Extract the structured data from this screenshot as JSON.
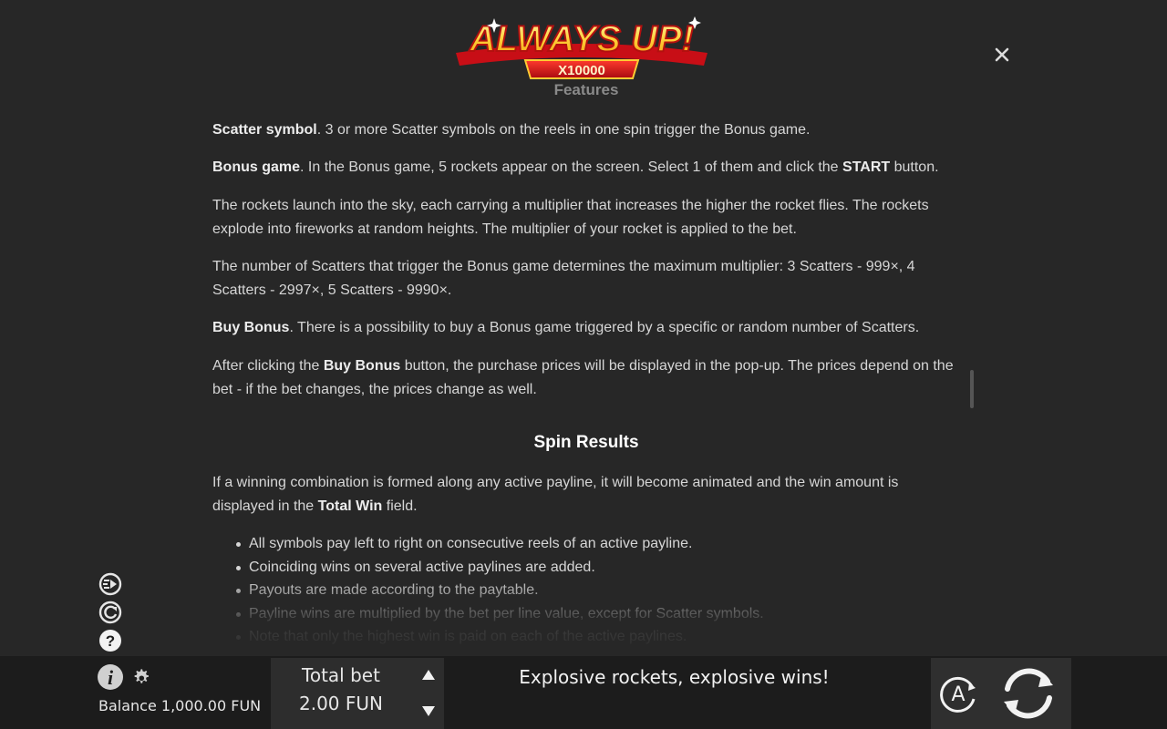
{
  "logo": {
    "text": "ALWAYS UP!",
    "sub": "X10000"
  },
  "rules": {
    "cut_heading": "Features",
    "scatter": {
      "term": "Scatter symbol",
      "text": ". 3 or more Scatter symbols on the reels in one spin trigger the Bonus game."
    },
    "bonus": {
      "term": "Bonus game",
      "text1": ". In the Bonus game, 5 rockets appear on the screen. Select 1 of them and click the ",
      "term2": "START",
      "text2": " button."
    },
    "rockets": "The rockets launch into the sky, each carrying a multiplier that increases the higher the rocket flies. The rockets explode into fireworks at random heights. The multiplier of your rocket is applied to the bet.",
    "scatters_count": "The number of Scatters that trigger the Bonus game determines the maximum multiplier: 3 Scatters - 999×, 4 Scatters - 2997×, 5 Scatters - 9990×.",
    "buy": {
      "term": "Buy Bonus",
      "text": ". There is a possibility to buy a Bonus game triggered by a specific or random number of Scatters."
    },
    "after": {
      "text1": "After clicking the ",
      "term": "Buy Bonus",
      "text2": " button, the purchase prices will be displayed in the pop-up. The prices depend on the bet - if the bet changes, the prices change as well."
    },
    "spin_heading": "Spin Results",
    "spin_intro": {
      "text1": "If a winning combination is formed along any active payline, it will become animated and the win amount is displayed in the ",
      "term": "Total Win",
      "text2": " field."
    },
    "bullets": [
      "All symbols pay left to right on consecutive reels of an active payline.",
      "Coinciding wins on several active paylines are added.",
      "Payouts are made according to the paytable.",
      "Payline wins are multiplied by the bet per line value, except for Scatter symbols.",
      "Note that only the highest win is paid on each of the active paylines."
    ]
  },
  "bottom": {
    "balance_label": "Balance",
    "balance_value": "1,000.00 FUN",
    "bet_label": "Total bet",
    "bet_value": "2.00 FUN",
    "message": "Explosive rockets, explosive wins!",
    "auto_letter": "A"
  },
  "colors": {
    "background": "#272727",
    "bar": "#1c1c1c",
    "text": "#d6d6d6",
    "logo_red": "#d8141b",
    "logo_gold": "#ffd23a"
  }
}
